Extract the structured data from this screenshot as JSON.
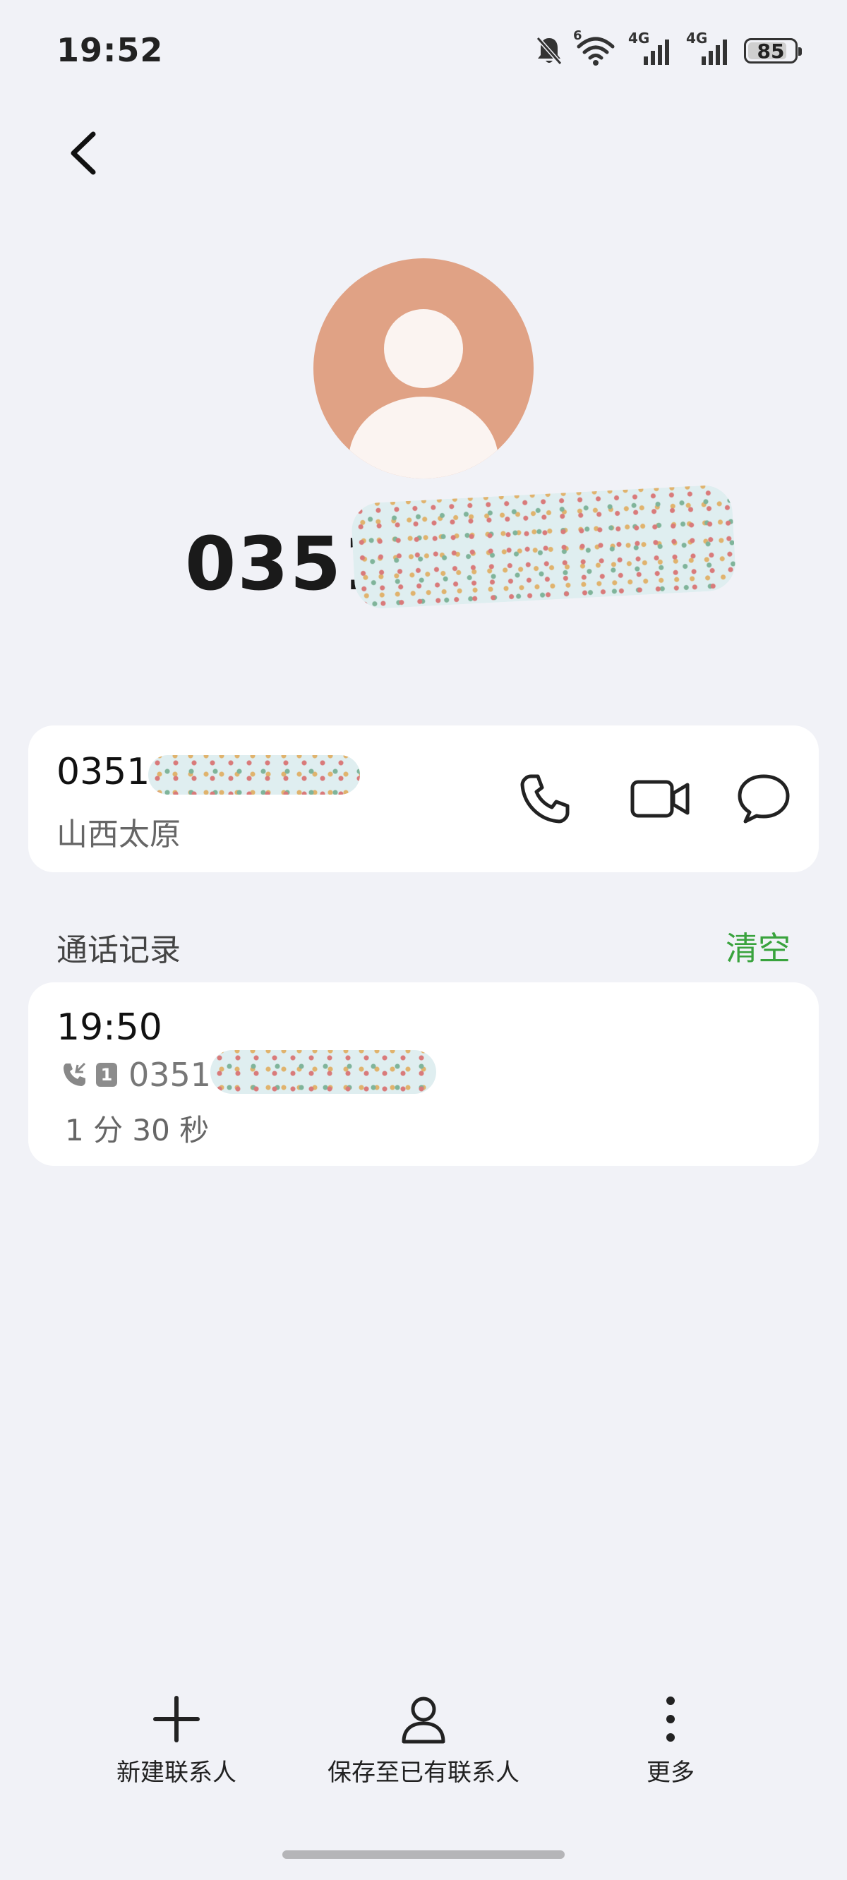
{
  "status_bar": {
    "time": "19:52",
    "wifi_badge": "6",
    "network_1": "4G",
    "network_2": "4G",
    "battery": "85",
    "battery_level": 0.85,
    "icons": [
      "mute-bell-icon",
      "wifi-icon",
      "signal-icon",
      "signal-icon",
      "battery-icon"
    ]
  },
  "header": {
    "back_icon": "chevron-left-icon"
  },
  "contact": {
    "avatar_icon": "person-avatar-icon",
    "avatar_color": "#e0a285",
    "display_number": "0351"
  },
  "number_card": {
    "number": "0351",
    "location": "山西太原",
    "actions": [
      "phone-icon",
      "video-call-icon",
      "message-icon"
    ]
  },
  "call_log": {
    "title": "通话记录",
    "clear_label": "清空",
    "clear_color": "#39a33d",
    "entries": [
      {
        "time": "19:50",
        "type_icon": "incoming-call-icon",
        "sim": "1",
        "number": "0351",
        "duration": "1 分 30 秒"
      }
    ]
  },
  "bottom_bar": {
    "new_contact": "新建联系人",
    "save_existing": "保存至已有联系人",
    "more": "更多"
  }
}
